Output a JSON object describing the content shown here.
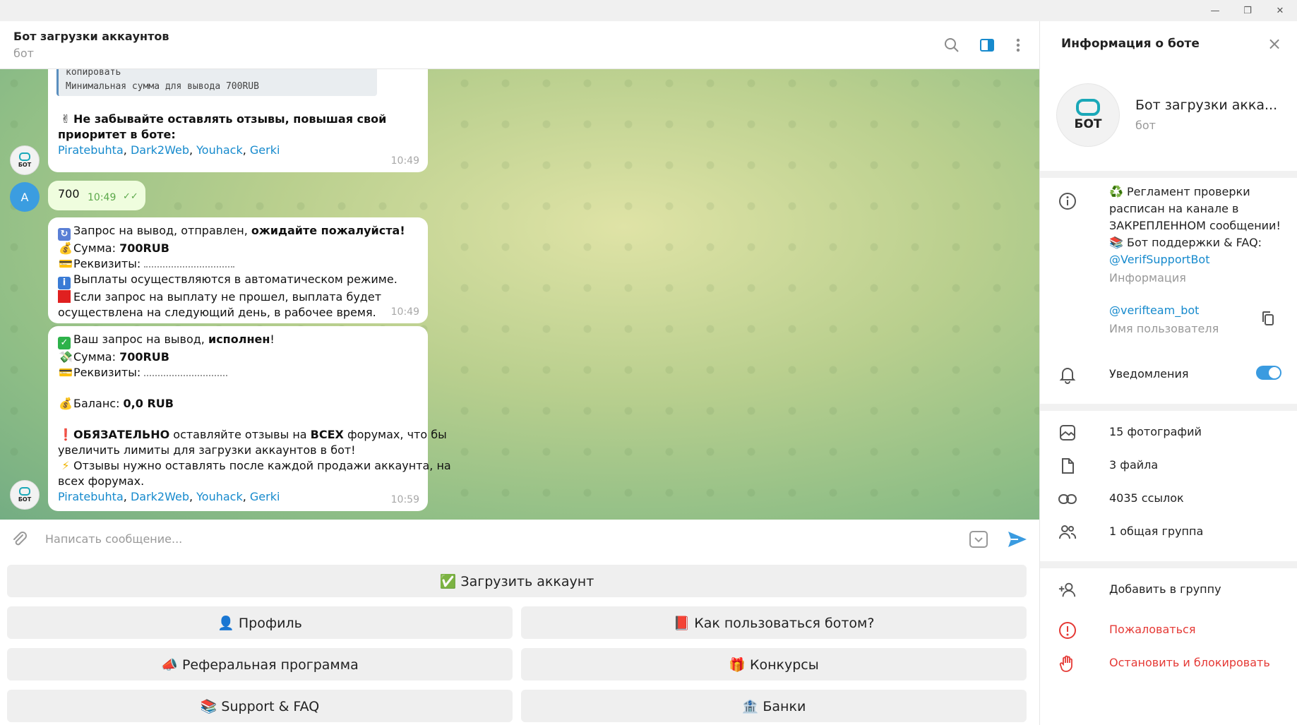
{
  "window": {
    "minimize": "—",
    "restore": "❐",
    "close": "✕"
  },
  "header": {
    "title": "Бот загрузки аккаунтов",
    "subtitle": "бот"
  },
  "messages": {
    "m1": {
      "code_top": "копировать",
      "code_line": "Минимальная сумма для вывода 700RUB",
      "emoji": "✌",
      "text_l1": "Не забывайте оставлять отзывы, повышая свой",
      "text_l2": "приоритет в боте:",
      "links": [
        "Piratebuhta",
        "Dark2Web",
        "Youhack",
        "Gerki"
      ],
      "time": "10:49"
    },
    "m2": {
      "avatar": "A",
      "text": "700",
      "time": "10:49",
      "ticks": "✓✓"
    },
    "m3": {
      "l1_a": "Запрос на вывод,  отправлен, ",
      "l1_b": "ожидайте пожалуйста!",
      "l2_a": "Сумма: ",
      "l2_b": "700RUB",
      "l3": "Реквизиты: ",
      "l4": "Выплаты осуществляются в автоматическом режиме.",
      "l5": "Если запрос на выплату не прошел, выплата будет",
      "l6": "осуществлена на следующий день, в рабочее время.",
      "time": "10:49"
    },
    "m4": {
      "l1_a": "Ваш запрос на вывод, ",
      "l1_b": "исполнен",
      "l1_c": "!",
      "l2_a": "Сумма: ",
      "l2_b": "700RUB",
      "l3": "Реквизиты: ",
      "l5_a": "Баланс: ",
      "l5_b": "0,0 RUB",
      "l7_a": "ОБЯЗАТЕЛЬНО",
      "l7_b": " оставляйте отзывы на ",
      "l7_c": "ВСЕХ",
      "l7_d": " форумах, что бы",
      "l8": "увеличить лимиты для загрузки аккаунтов в бот!",
      "l9": "Отзывы нужно оставлять после каждой продажи аккаунта, на",
      "l10": "всех форумах.",
      "links": [
        "Piratebuhta",
        "Dark2Web",
        "Youhack",
        "Gerki"
      ],
      "time": "10:59"
    }
  },
  "bot_avatar_text": "БОТ",
  "input": {
    "placeholder": "Написать сообщение..."
  },
  "keyboard": [
    {
      "label": "✅ Загрузить аккаунт"
    },
    {
      "label": "👤 Профиль"
    },
    {
      "label": "📕 Как пользоваться ботом?"
    },
    {
      "label": "📣 Реферальная программа"
    },
    {
      "label": "🎁 Конкурсы"
    },
    {
      "label": "📚 Support & FAQ"
    },
    {
      "label": "🏦 Банки"
    }
  ],
  "panel": {
    "title": "Информация о боте",
    "name": "Бот загрузки акка...",
    "sub": "бот",
    "info_l1": "♻️ Регламент проверки",
    "info_l2": "расписан на канале в",
    "info_l3": "ЗАКРЕПЛЕННОМ сообщении!",
    "info_l4": "📚 Бот поддержки & FAQ:",
    "info_link": "@VerifSupportBot",
    "info_caption": "Информация",
    "username": "@verifteam_bot",
    "username_caption": "Имя пользователя",
    "notifications": "Уведомления",
    "notifications_on": true,
    "photos": "15 фотографий",
    "files": "3 файла",
    "links": "4035 ссылок",
    "groups": "1 общая группа",
    "add_group": "Добавить в группу",
    "report": "Пожаловаться",
    "block": "Остановить и блокировать"
  },
  "colors": {
    "accent": "#168acd",
    "toggle": "#3a9be0",
    "danger": "#e53935",
    "send": "#3a9be0"
  }
}
